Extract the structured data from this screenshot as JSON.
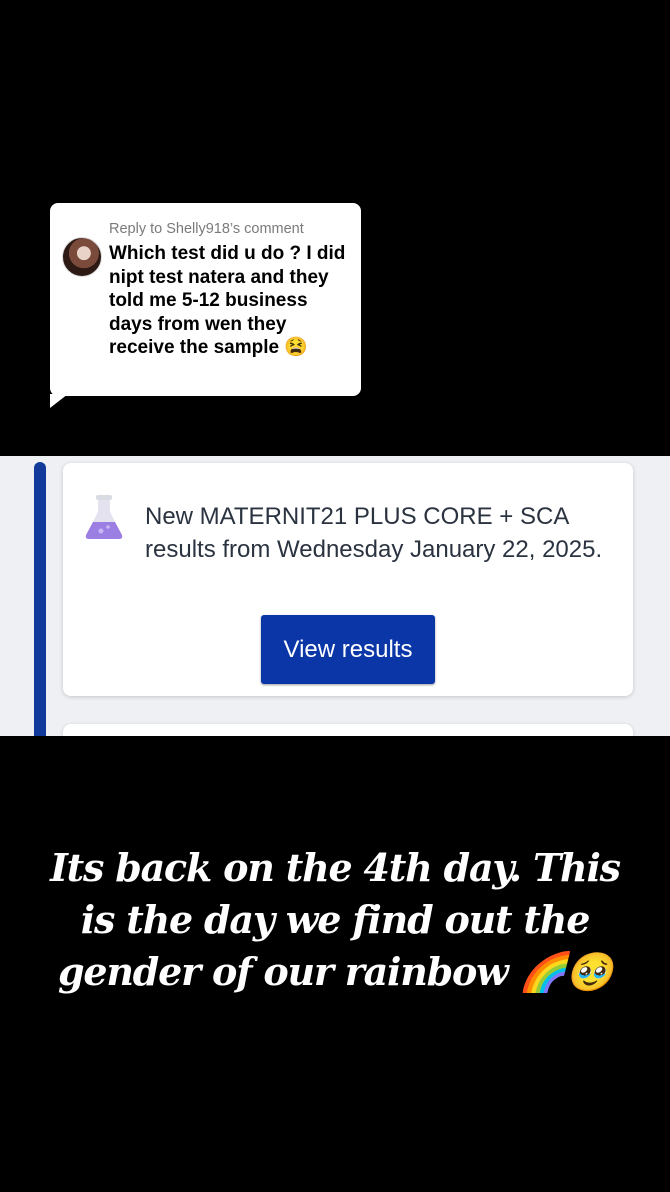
{
  "reply": {
    "header": "Reply to Shelly918’s comment",
    "text": "Which test did u do ? I did nipt test natera and they told me 5-12 business days from wen they receive the sample 😫"
  },
  "notification": {
    "message": "New MATERNIT21 PLUS CORE + SCA results from Wednesday January 22, 2025.",
    "button_label": "View results",
    "icon": "flask-icon",
    "accent_color": "#123a9b",
    "button_color": "#0b36a8",
    "flask_color": "#9b7fe3"
  },
  "caption": {
    "text": "Its back on the 4th day. This is the day we find out the gender of our rainbow 🌈🥹"
  }
}
